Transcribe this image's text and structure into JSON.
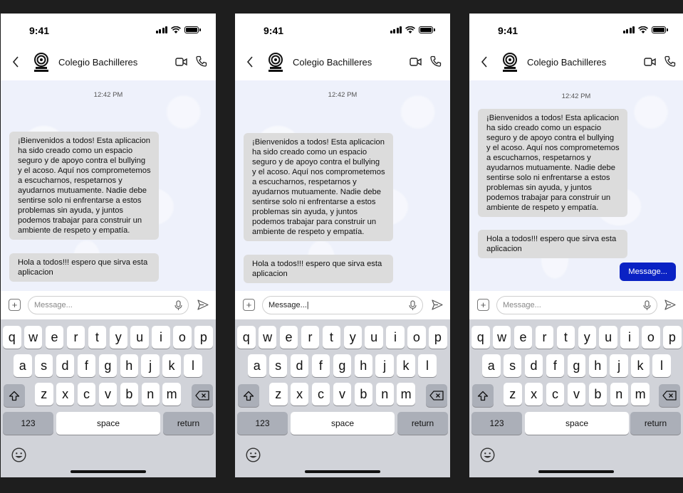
{
  "screens": [
    {
      "status_time": "9:41",
      "contact_name": "Colegio Bachilleres",
      "timestamp": "12:42 PM",
      "messages": [
        "¡Bienvenidos a todos! Esta aplicacion ha sido creado como un espacio seguro y de apoyo contra el bullying y el acoso. Aquí nos comprometemos a escucharnos, respetarnos y ayudarnos mutuamente. Nadie debe sentirse solo ni enfrentarse a estos problemas sin ayuda, y juntos podemos trabajar para construir un ambiente de respeto y empatía.",
        "Hola a todos!!! espero que sirva esta aplicacion"
      ],
      "input_placeholder": "Message...",
      "input_value": ""
    },
    {
      "status_time": "9:41",
      "contact_name": "Colegio Bachilleres",
      "timestamp": "12:42 PM",
      "messages": [
        "¡Bienvenidos a todos! Esta aplicacion ha sido creado como un espacio seguro y de apoyo contra el bullying y el acoso. Aquí nos comprometemos a escucharnos, respetarnos y ayudarnos mutuamente. Nadie debe sentirse solo ni enfrentarse a estos problemas sin ayuda, y juntos podemos trabajar para construir un ambiente de respeto y empatía.",
        "Hola a todos!!! espero que sirva esta aplicacion"
      ],
      "input_placeholder": "Message...",
      "input_value": "Message...|"
    },
    {
      "status_time": "9:41",
      "contact_name": "Colegio Bachilleres",
      "timestamp": "12:42 PM",
      "messages": [
        "¡Bienvenidos a todos! Esta aplicacion ha sido creado como un espacio seguro y de apoyo contra el bullying y el acoso. Aquí nos comprometemos a escucharnos, respetarnos y ayudarnos mutuamente. Nadie debe sentirse solo ni enfrentarse a estos problemas sin ayuda, y juntos podemos trabajar para construir un ambiente de respeto y empatía.",
        "Hola a todos!!! espero que sirva esta aplicacion"
      ],
      "sent_message": "Message...",
      "input_placeholder": "Message...",
      "input_value": ""
    }
  ],
  "keyboard": {
    "row1": [
      "q",
      "w",
      "e",
      "r",
      "t",
      "y",
      "u",
      "i",
      "o",
      "p"
    ],
    "row2": [
      "a",
      "s",
      "d",
      "f",
      "g",
      "h",
      "j",
      "k",
      "l"
    ],
    "row3": [
      "z",
      "x",
      "c",
      "v",
      "b",
      "n",
      "m"
    ],
    "numbers_label": "123",
    "space_label": "space",
    "return_label": "return"
  },
  "colors": {
    "background": "#1e1e1e",
    "chat_background": "#eef1fb",
    "incoming_bubble": "#dcdcdc",
    "outgoing_bubble": "#0a22c4",
    "keyboard_background": "#d1d3d9"
  },
  "icons": [
    "back-chevron-icon",
    "school-logo-icon",
    "video-call-icon",
    "phone-call-icon",
    "plus-icon",
    "microphone-icon",
    "send-icon",
    "shift-icon",
    "backspace-icon",
    "emoji-icon",
    "signal-icon",
    "wifi-icon",
    "battery-icon"
  ]
}
